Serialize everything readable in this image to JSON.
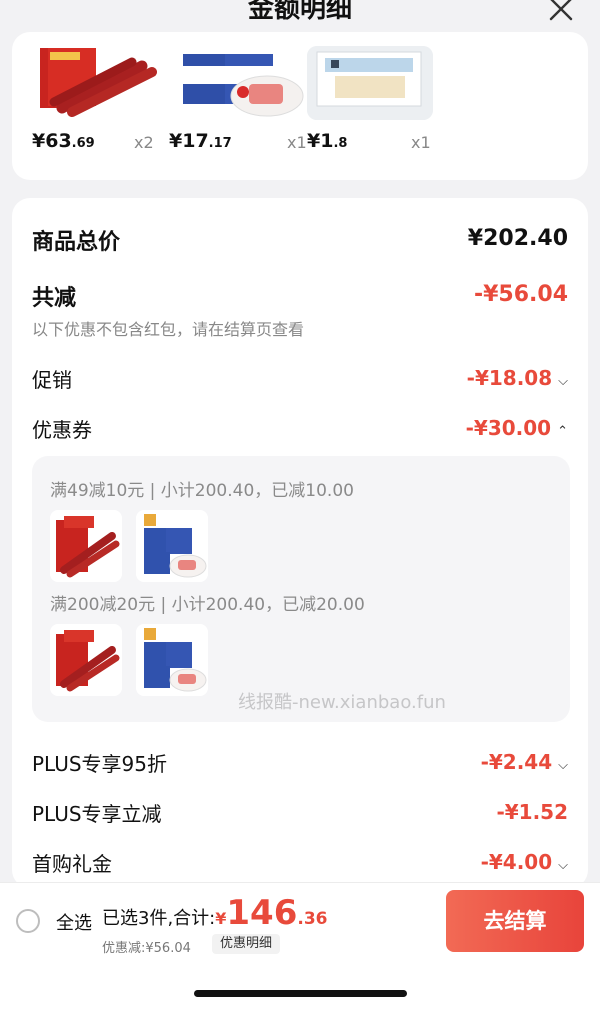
{
  "header": {
    "title": "金额明细",
    "close_icon": "close-icon"
  },
  "products": [
    {
      "price_int": "¥63",
      "price_dec": ".69",
      "qty": "x2",
      "image": "sausage-gift-box"
    },
    {
      "price_int": "¥17",
      "price_dec": ".17",
      "qty": "x1",
      "image": "luncheon-meat-cans"
    },
    {
      "price_int": "¥1",
      "price_dec": ".8",
      "qty": "x1",
      "image": "toothpick-pack"
    }
  ],
  "summary": {
    "total_label": "商品总价",
    "total_value": "¥202.40",
    "discount_label": "共减",
    "discount_value": "-¥56.04",
    "hint": "以下优惠不包含红包，请在结算页查看",
    "promo_label": "促销",
    "promo_value": "-¥18.08",
    "coupon_label": "优惠券",
    "coupon_value": "-¥30.00",
    "plus95_label": "PLUS专享95折",
    "plus95_value": "-¥2.44",
    "plusdirect_label": "PLUS专享立减",
    "plusdirect_value": "-¥1.52",
    "firstbuy_label": "首购礼金",
    "firstbuy_value": "-¥4.00"
  },
  "coupons": [
    {
      "text": "满49减10元 | 小计200.40，已减10.00"
    },
    {
      "text": "满200减20元 | 小计200.40，已减20.00"
    }
  ],
  "watermark": "线报酷-new.xianbao.fun",
  "bottom": {
    "select_all": "全选",
    "selected_text": "已选3件,合计:",
    "currency": "¥",
    "total_int": "146",
    "total_dec": ".36",
    "saved": "优惠减:¥56.04",
    "detail_button": "优惠明细",
    "checkout_button": "去结算"
  },
  "colors": {
    "accent": "#e84a3b",
    "background": "#f2f2f4"
  }
}
